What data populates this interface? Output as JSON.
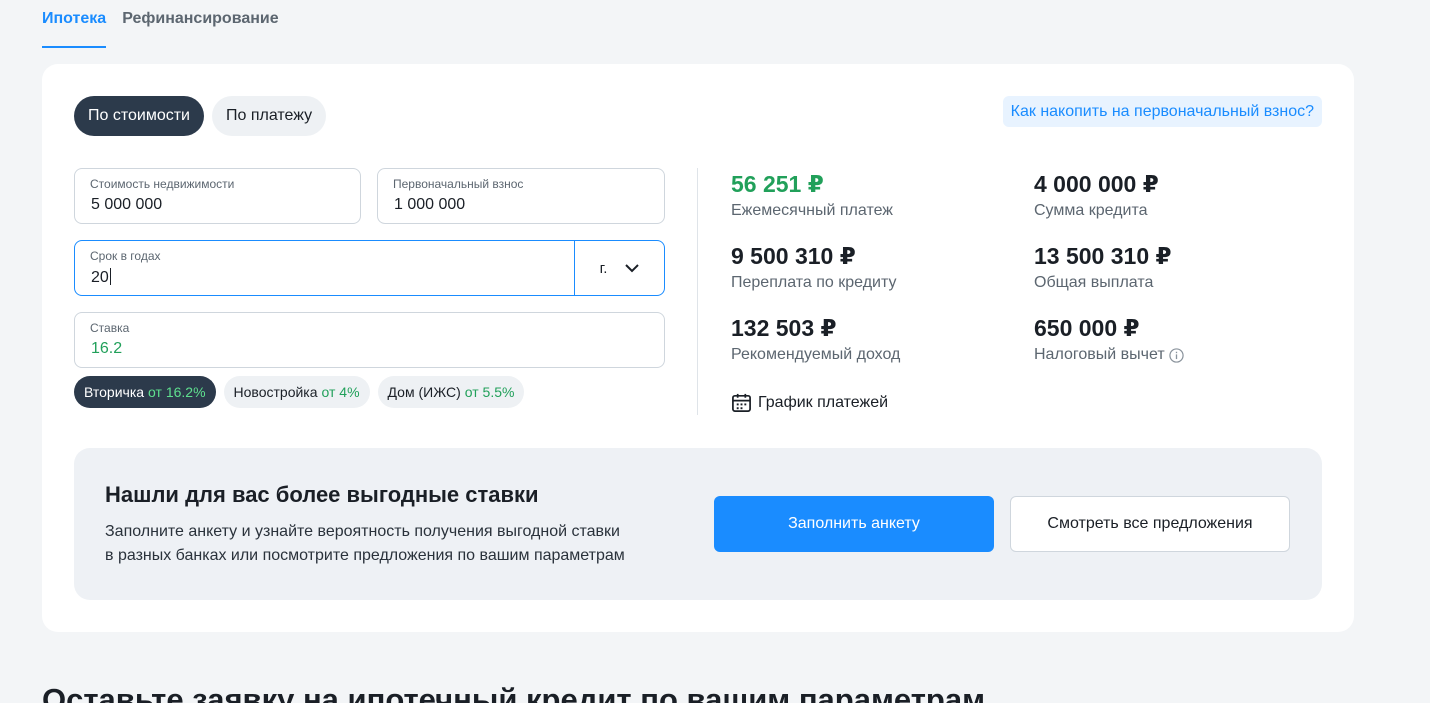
{
  "tabs": [
    {
      "label": "Ипотека",
      "active": true
    },
    {
      "label": "Рефинансирование",
      "active": false
    }
  ],
  "mode": {
    "by_price": "По стоимости",
    "by_payment": "По платежу"
  },
  "help_link": "Как накопить на первоначальный взнос?",
  "fields": {
    "price": {
      "label": "Стоимость недвижимости",
      "value": "5 000 000"
    },
    "down_payment": {
      "label": "Первоначальный взнос",
      "value": "1 000 000"
    },
    "term": {
      "label": "Срок в годах",
      "value": "20",
      "unit": "г."
    },
    "rate": {
      "label": "Ставка",
      "value": "16.2"
    }
  },
  "chips": [
    {
      "label": "Вторичка",
      "rate": "от 16.2%"
    },
    {
      "label": "Новостройка",
      "rate": "от 4%"
    },
    {
      "label": "Дом (ИЖС)",
      "rate": "от 5.5%"
    }
  ],
  "results": {
    "monthly": {
      "value": "56 251 ₽",
      "caption": "Ежемесячный платеж"
    },
    "loan": {
      "value": "4 000 000 ₽",
      "caption": "Сумма кредита"
    },
    "overpay": {
      "value": "9 500 310 ₽",
      "caption": "Переплата по кредиту"
    },
    "total": {
      "value": "13 500 310 ₽",
      "caption": "Общая выплата"
    },
    "income": {
      "value": "132 503 ₽",
      "caption": "Рекомендуемый доход"
    },
    "tax": {
      "value": "650 000 ₽",
      "caption": "Налоговый вычет"
    }
  },
  "schedule_link": "График платежей",
  "promo": {
    "title": "Нашли для вас более выгодные ставки",
    "text_line1": "Заполните анкету и узнайте вероятность получения выгодной ставки",
    "text_line2": "в разных банках или посмотрите предложения по вашим параметрам",
    "primary_button": "Заполнить анкету",
    "secondary_button": "Смотреть все предложения"
  },
  "bottom_heading": "Оставьте заявку на ипотечный кредит по вашим параметрам",
  "colors": {
    "accent": "#1a8cff",
    "green": "#21a05a",
    "dark": "#2c3a4b"
  }
}
